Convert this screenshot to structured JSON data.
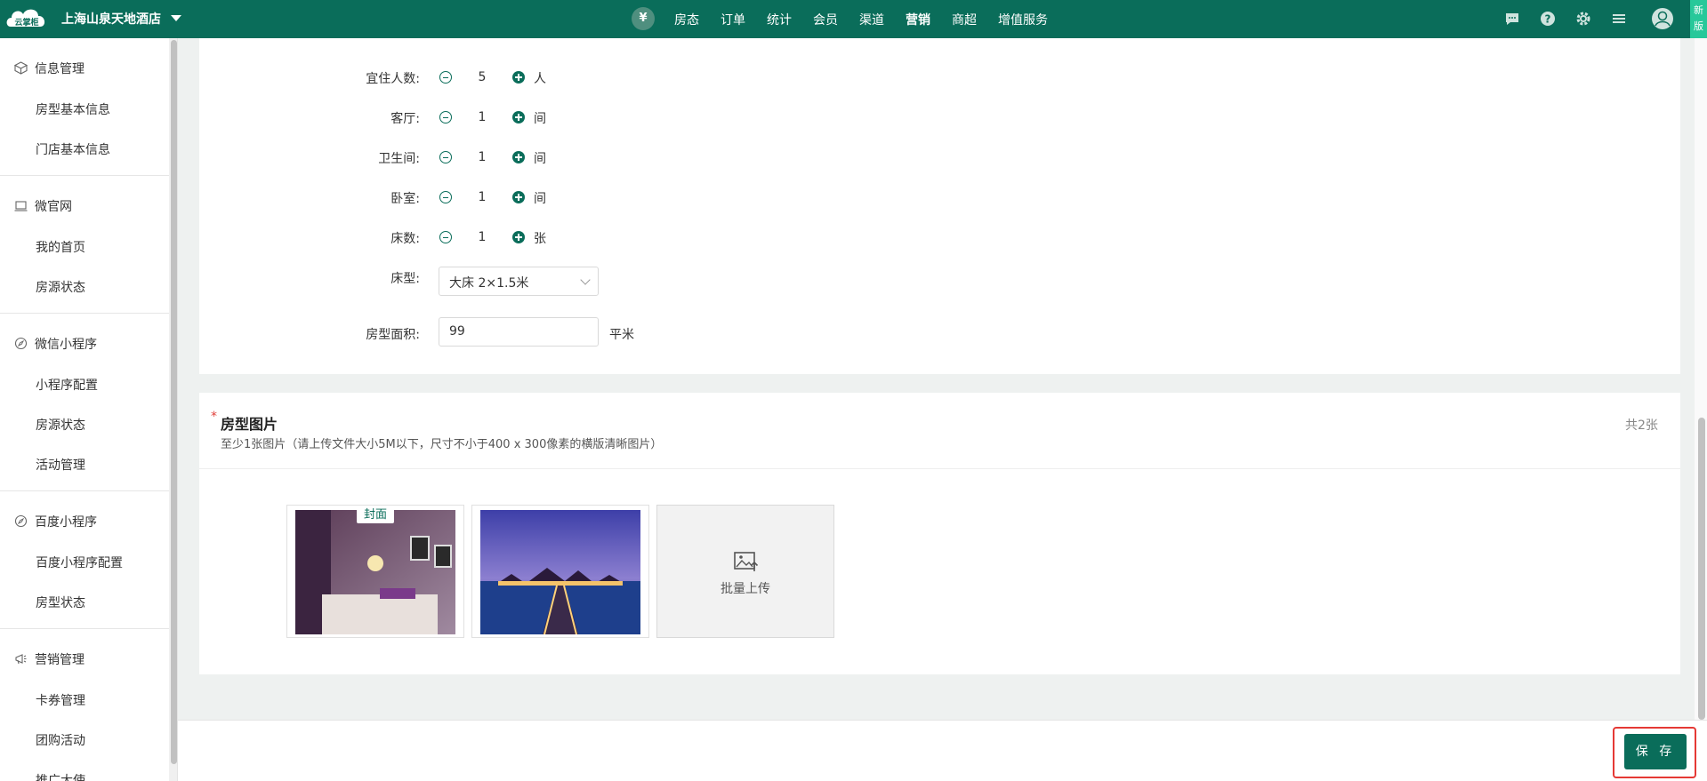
{
  "topbar": {
    "hotel_name": "上海山泉天地酒店",
    "logo_text": "云掌柜",
    "yuan_symbol": "¥",
    "nav": [
      "房态",
      "订单",
      "统计",
      "会员",
      "渠道",
      "营销",
      "商超",
      "增值服务"
    ],
    "active_nav": "营销",
    "new_version": "新版"
  },
  "sidebar": {
    "groups": [
      {
        "label": "信息管理",
        "icon": "cube-icon",
        "items": [
          "房型基本信息",
          "门店基本信息"
        ]
      },
      {
        "label": "微官网",
        "icon": "laptop-icon",
        "items": [
          "我的首页",
          "房源状态"
        ]
      },
      {
        "label": "微信小程序",
        "icon": "compass-icon",
        "items": [
          "小程序配置",
          "房源状态",
          "活动管理"
        ]
      },
      {
        "label": "百度小程序",
        "icon": "compass-icon",
        "items": [
          "百度小程序配置",
          "房型状态"
        ]
      },
      {
        "label": "营销管理",
        "icon": "megaphone-icon",
        "items": [
          "卡券管理",
          "团购活动",
          "推广大使"
        ]
      }
    ]
  },
  "form": {
    "occupancy": {
      "label": "宜住人数:",
      "value": "5",
      "unit": "人"
    },
    "living_room": {
      "label": "客厅:",
      "value": "1",
      "unit": "间"
    },
    "bathroom": {
      "label": "卫生间:",
      "value": "1",
      "unit": "间"
    },
    "bedroom": {
      "label": "卧室:",
      "value": "1",
      "unit": "间"
    },
    "beds": {
      "label": "床数:",
      "value": "1",
      "unit": "张"
    },
    "bed_type": {
      "label": "床型:",
      "value": "大床 2×1.5米"
    },
    "area": {
      "label": "房型面积:",
      "value": "99",
      "unit": "平米"
    }
  },
  "photos": {
    "required_mark": "*",
    "title": "房型图片",
    "subtitle": "至少1张图片（请上传文件大小5M以下，尺寸不小于400 x 300像素的横版清晰图片）",
    "count": "共2张",
    "cover_tag": "封面",
    "upload_label": "批量上传"
  },
  "footer": {
    "save_label": "保 存"
  },
  "colors": {
    "brand": "#0a6d5a",
    "highlight": "#e53935",
    "new_badge": "#27c89a"
  }
}
